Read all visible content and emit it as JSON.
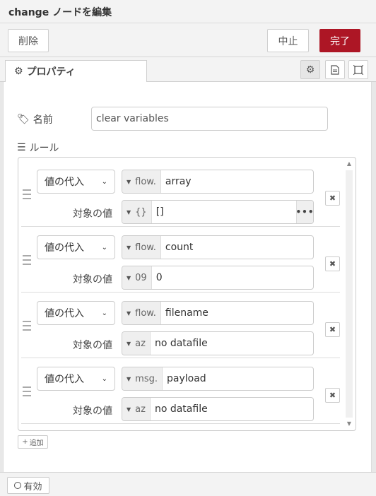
{
  "header": {
    "title": "change ノードを編集"
  },
  "toolbar": {
    "delete_label": "削除",
    "cancel_label": "中止",
    "done_label": "完了"
  },
  "tabs": {
    "properties_label": "プロパティ"
  },
  "form": {
    "name_label": "名前",
    "name_value": "clear variables",
    "rules_label": "ルール",
    "target_label": "対象の値"
  },
  "rules": [
    {
      "action": "値の代入",
      "prop_type": "flow.",
      "prop_value": "array",
      "to_type": "{}",
      "to_value": "[]",
      "has_expand": true
    },
    {
      "action": "値の代入",
      "prop_type": "flow.",
      "prop_value": "count",
      "to_type": "09",
      "to_value": "0",
      "has_expand": false
    },
    {
      "action": "値の代入",
      "prop_type": "flow.",
      "prop_value": "filename",
      "to_type": "az",
      "to_value": "no datafile",
      "has_expand": false
    },
    {
      "action": "値の代入",
      "prop_type": "msg.",
      "prop_value": "payload",
      "to_type": "az",
      "to_value": "no datafile",
      "has_expand": false
    }
  ],
  "add_label": "追加",
  "footer": {
    "enabled_label": "有効"
  },
  "colors": {
    "done_bg": "#ad1625"
  }
}
